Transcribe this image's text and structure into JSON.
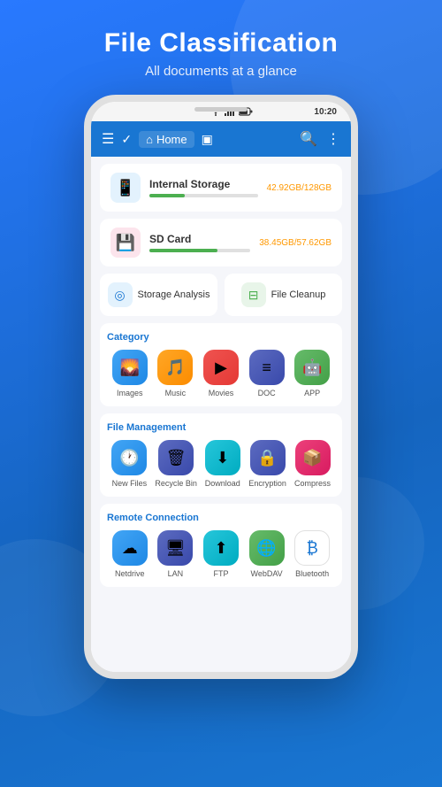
{
  "header": {
    "title": "File Classification",
    "subtitle": "All documents at a glance"
  },
  "phone": {
    "status_bar": {
      "time": "10:20"
    },
    "app_bar": {
      "home_label": "Home"
    },
    "storage": [
      {
        "name": "Internal Storage",
        "used": "42.92GB",
        "total": "128GB",
        "percent": 33,
        "type": "internal"
      },
      {
        "name": "SD Card",
        "used": "38.45GB",
        "total": "57.62GB",
        "percent": 67,
        "type": "sdcard"
      }
    ],
    "quick_actions": [
      {
        "label": "Storage Analysis",
        "icon_type": "blue"
      },
      {
        "label": "File Cleanup",
        "icon_type": "green"
      }
    ],
    "category": {
      "section_title": "Category",
      "items": [
        {
          "label": "Images",
          "icon_class": "ic-images"
        },
        {
          "label": "Music",
          "icon_class": "ic-music"
        },
        {
          "label": "Movies",
          "icon_class": "ic-movies"
        },
        {
          "label": "DOC",
          "icon_class": "ic-doc"
        },
        {
          "label": "APP",
          "icon_class": "ic-app"
        }
      ]
    },
    "file_management": {
      "section_title": "File Management",
      "items": [
        {
          "label": "New Files",
          "icon_class": "ic-newfiles"
        },
        {
          "label": "Recycle Bin",
          "icon_class": "ic-recycle"
        },
        {
          "label": "Download",
          "icon_class": "ic-download"
        },
        {
          "label": "Encryption",
          "icon_class": "ic-encryption"
        },
        {
          "label": "Compress",
          "icon_class": "ic-compress"
        }
      ]
    },
    "remote_connection": {
      "section_title": "Remote Connection",
      "items": [
        {
          "label": "Netdrive",
          "icon_class": "ic-netdrive"
        },
        {
          "label": "LAN",
          "icon_class": "ic-lan"
        },
        {
          "label": "FTP",
          "icon_class": "ic-ftp"
        },
        {
          "label": "WebDAV",
          "icon_class": "ic-webdav"
        },
        {
          "label": "Bluetooth",
          "icon_class": "ic-bluetooth"
        }
      ]
    }
  }
}
